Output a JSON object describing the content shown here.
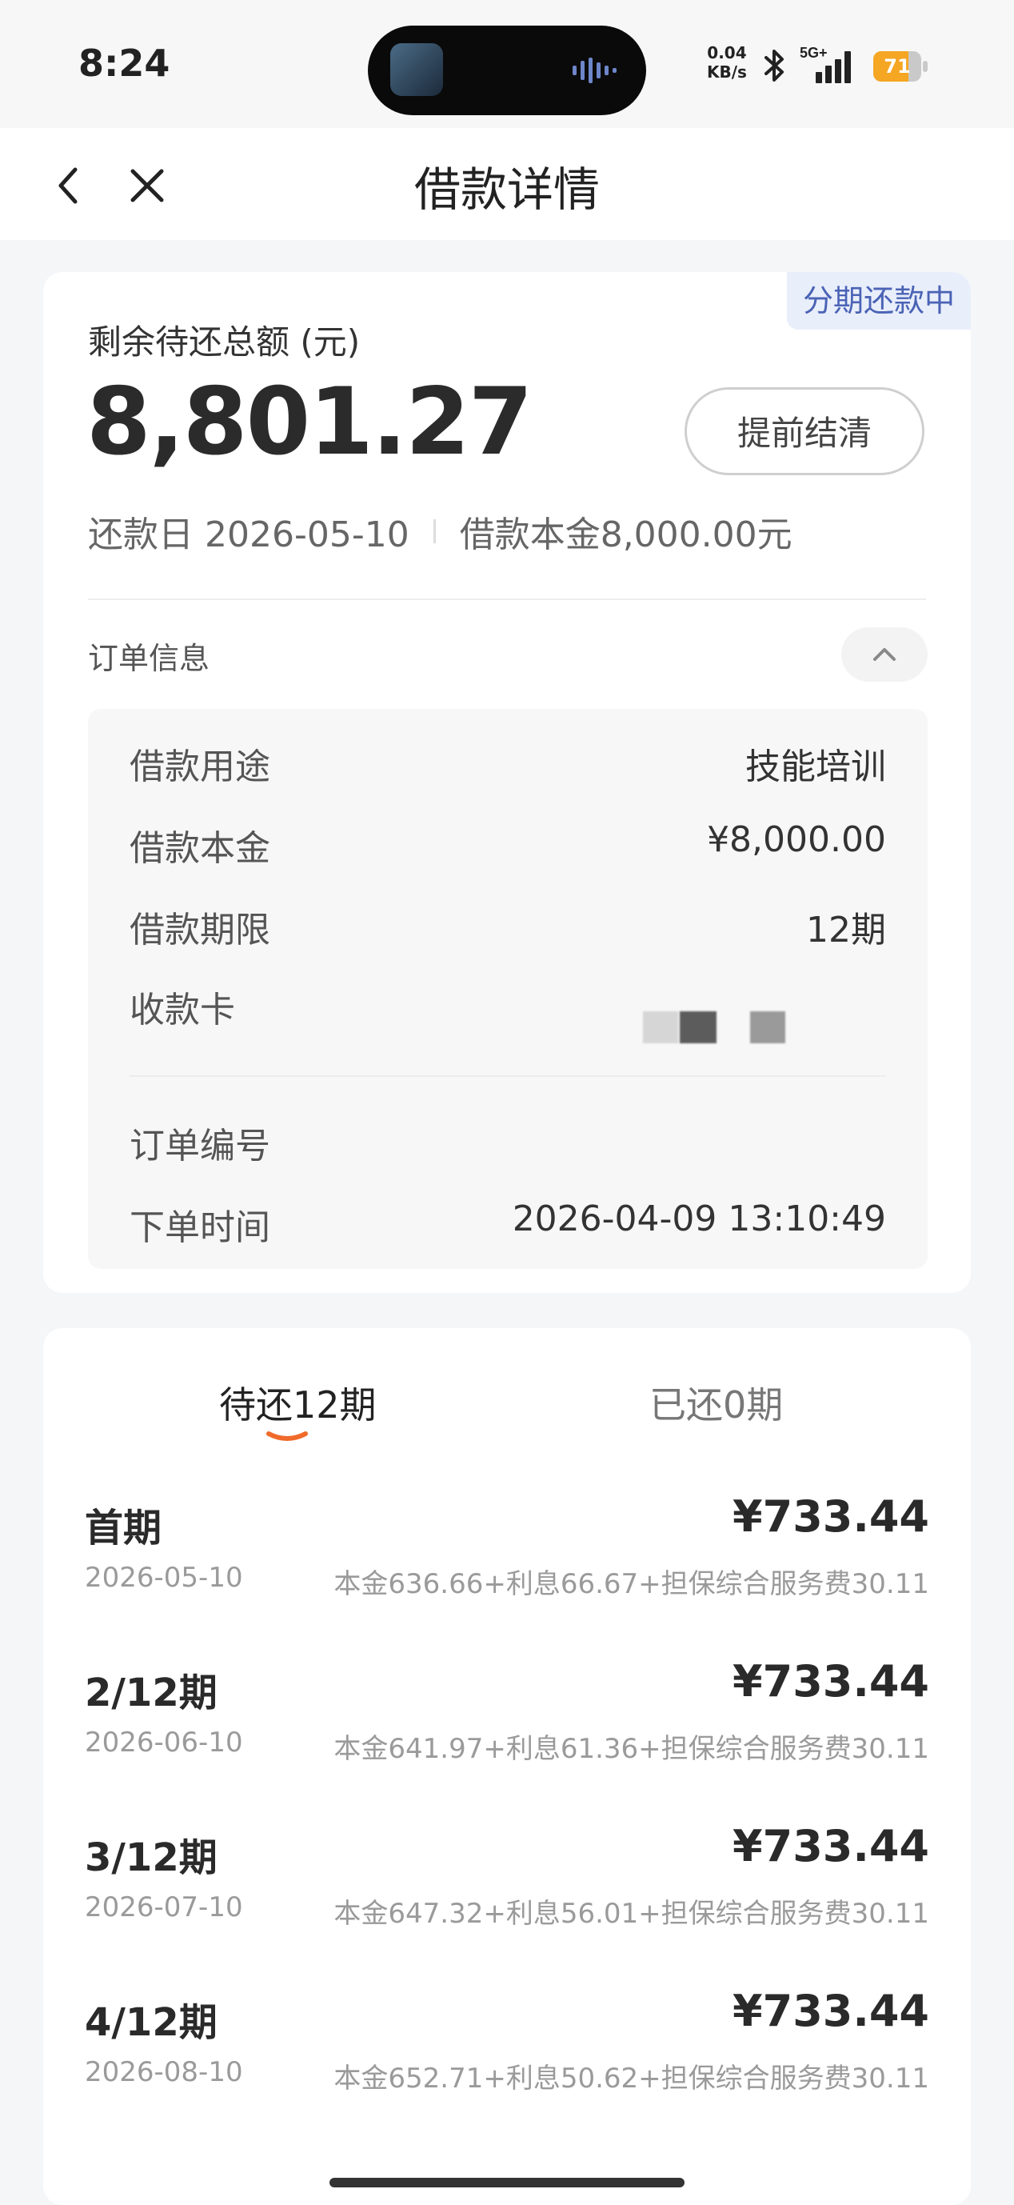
{
  "status_bar": {
    "time": "8:24",
    "net_speed_value": "0.04",
    "net_speed_unit": "KB/s",
    "network": "5G+",
    "battery": "71",
    "battery_color": "#f5a623"
  },
  "nav": {
    "title": "借款详情",
    "back_icon": "chevron-left-icon",
    "close_icon": "close-icon"
  },
  "summary": {
    "status_tag": "分期还款中",
    "label": "剩余待还总额 (元)",
    "amount": "8,801.27",
    "prepay_button": "提前结清",
    "due_date": "还款日 2026-05-10",
    "principal": "借款本金8,000.00元"
  },
  "order": {
    "title": "订单信息",
    "rows": [
      {
        "label": "借款用途",
        "value": "技能培训"
      },
      {
        "label": "借款本金",
        "value": "¥8,000.00"
      },
      {
        "label": "借款期限",
        "value": "12期"
      },
      {
        "label": "收款卡",
        "value": ""
      },
      {
        "label": "订单编号",
        "value": ""
      },
      {
        "label": "下单时间",
        "value": "2026-04-09 13:10:49"
      }
    ]
  },
  "plan": {
    "tabs": [
      {
        "label": "待还12期",
        "active": true
      },
      {
        "label": "已还0期",
        "active": false
      }
    ],
    "accent": "#f06a2a",
    "installments": [
      {
        "name": "首期",
        "date": "2026-05-10",
        "amount": "¥733.44",
        "breakdown": "本金636.66+利息66.67+担保综合服务费30.11"
      },
      {
        "name": "2/12期",
        "date": "2026-06-10",
        "amount": "¥733.44",
        "breakdown": "本金641.97+利息61.36+担保综合服务费30.11"
      },
      {
        "name": "3/12期",
        "date": "2026-07-10",
        "amount": "¥733.44",
        "breakdown": "本金647.32+利息56.01+担保综合服务费30.11"
      },
      {
        "name": "4/12期",
        "date": "2026-08-10",
        "amount": "¥733.44",
        "breakdown": "本金652.71+利息50.62+担保综合服务费30.11"
      }
    ]
  }
}
